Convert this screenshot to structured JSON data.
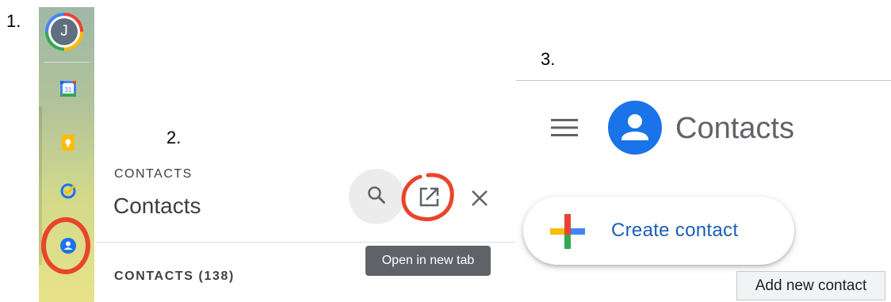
{
  "steps": [
    "1.",
    "2.",
    "3."
  ],
  "panel1": {
    "avatar_letter": "J",
    "apps": [
      {
        "name": "Calendar",
        "icon": "calendar-icon",
        "text": "31"
      },
      {
        "name": "Keep",
        "icon": "keep-icon"
      },
      {
        "name": "Tasks",
        "icon": "tasks-icon"
      },
      {
        "name": "Contacts",
        "icon": "contacts-icon"
      }
    ],
    "highlight_color": "#e8452b"
  },
  "panel2": {
    "section_title": "CONTACTS",
    "title": "Contacts",
    "actions": [
      {
        "icon": "search-icon"
      },
      {
        "icon": "open-in-new-tab-icon"
      },
      {
        "icon": "close-icon"
      }
    ],
    "tooltip": "Open in new tab",
    "list_header": "CONTACTS (138)"
  },
  "panel3": {
    "menu_icon": "hamburger-menu-icon",
    "app_icon": "contacts-logo-icon",
    "app_title": "Contacts",
    "create_label": "Create contact",
    "tooltip": "Add new contact",
    "brand_colors": {
      "blue": "#1a73e8",
      "red": "#ea4335",
      "yellow": "#fbbc04",
      "green": "#34a853"
    }
  }
}
